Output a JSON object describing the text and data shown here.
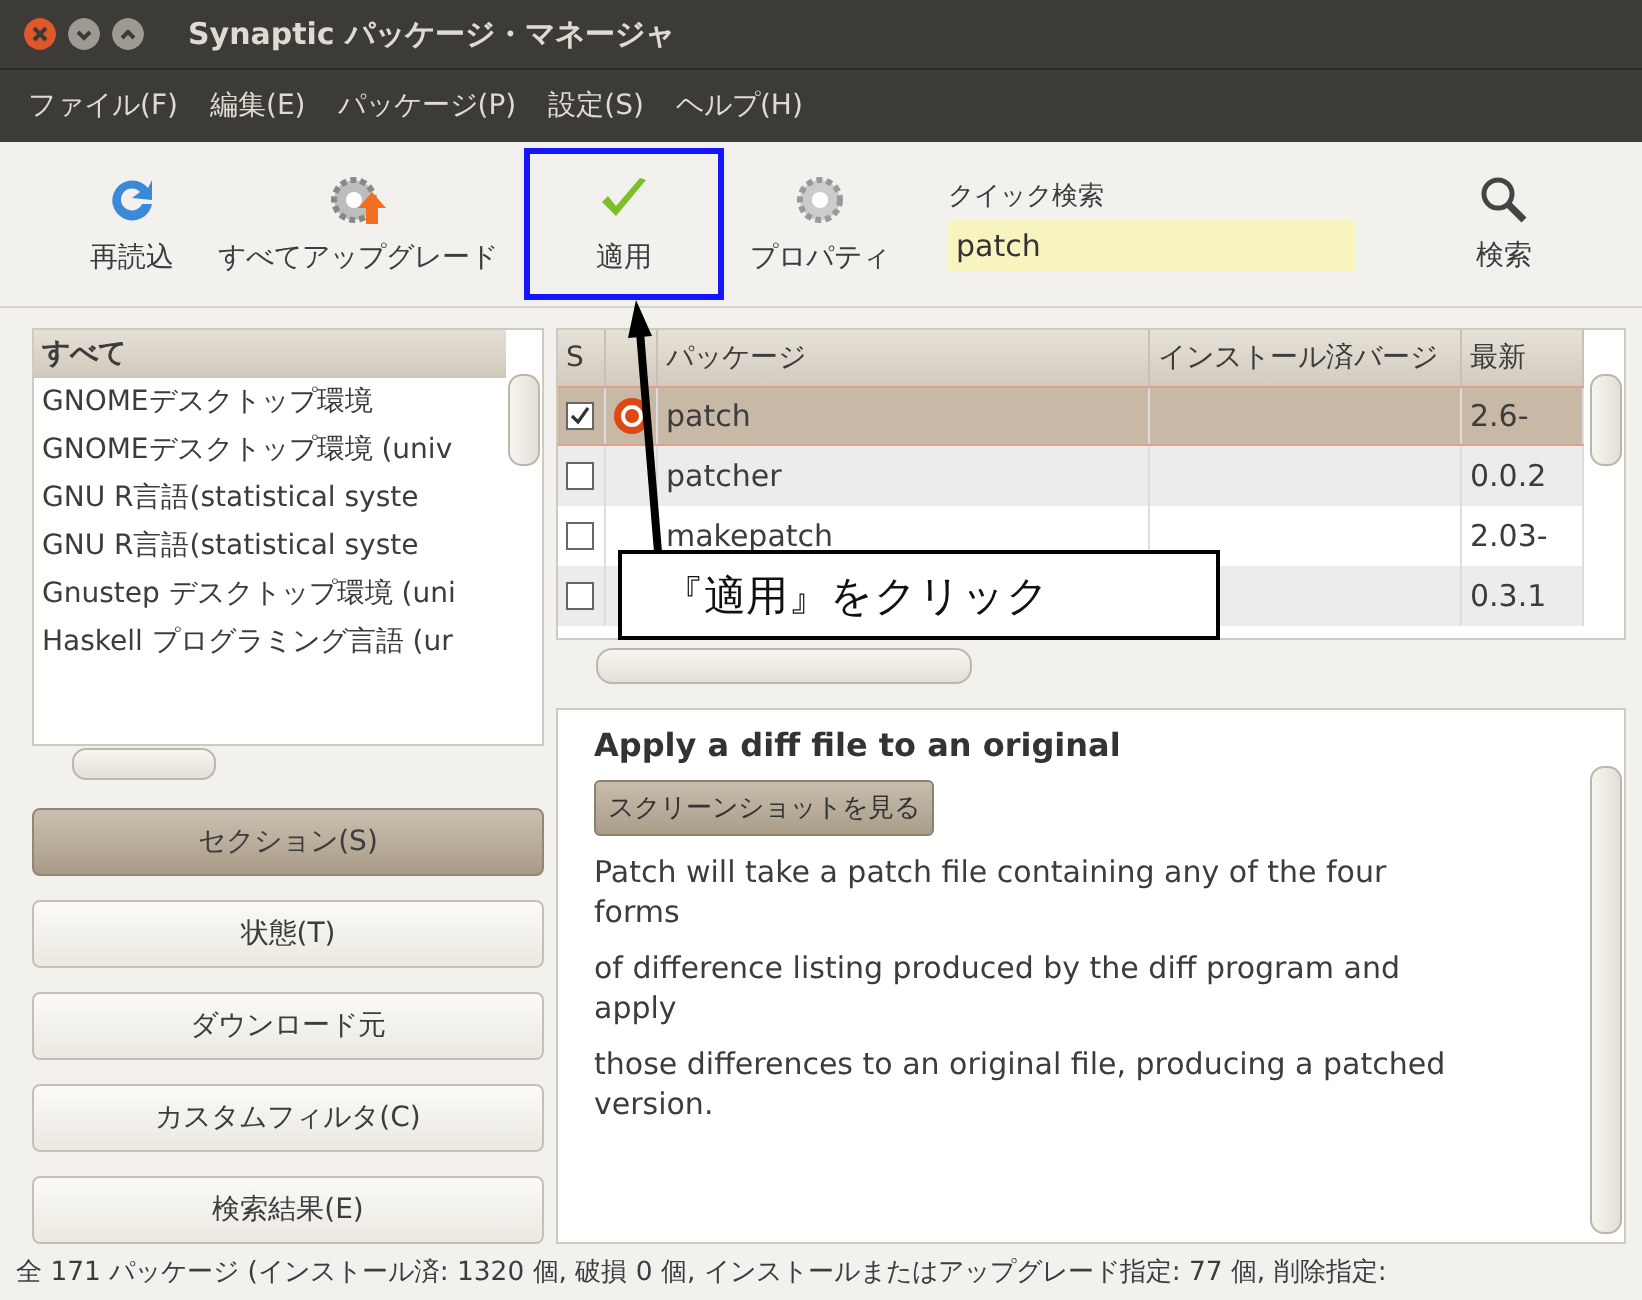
{
  "window": {
    "title": "Synaptic パッケージ・マネージャ"
  },
  "menu": [
    "ファイル(F)",
    "編集(E)",
    "パッケージ(P)",
    "設定(S)",
    "ヘルプ(H)"
  ],
  "toolbar": [
    {
      "label": "再読込",
      "kind": "reload",
      "highlighted": false
    },
    {
      "label": "すべてアップグレード",
      "kind": "upgrade",
      "highlighted": false
    },
    {
      "label": "適用",
      "kind": "apply",
      "highlighted": true
    },
    {
      "label": "プロパティ",
      "kind": "properties",
      "highlighted": false
    }
  ],
  "quick_search": {
    "label": "クイック検索",
    "value": "patch"
  },
  "search_button": {
    "label": "検索"
  },
  "categories": {
    "header": "すべて",
    "items": [
      "GNOMEデスクトップ環境",
      "GNOMEデスクトップ環境 (univ",
      "GNU R言語(statistical syste",
      "GNU R言語(statistical syste",
      "Gnustep デスクトップ環境 (uni",
      "Haskell プログラミング言語 (ur"
    ]
  },
  "filters": [
    {
      "label": "セクション(S)",
      "selected": true
    },
    {
      "label": "状態(T)",
      "selected": false
    },
    {
      "label": "ダウンロード元",
      "selected": false
    },
    {
      "label": "カスタムフィルタ(C)",
      "selected": false
    },
    {
      "label": "検索結果(E)",
      "selected": false
    }
  ],
  "table": {
    "columns": [
      "S",
      "パッケージ",
      "インストール済バージ",
      "最新"
    ],
    "rows": [
      {
        "checked": true,
        "selected": true,
        "supported": true,
        "name": "patch",
        "latest": "2.6-"
      },
      {
        "checked": false,
        "selected": false,
        "supported": false,
        "name": "patcher",
        "latest": "0.0.2"
      },
      {
        "checked": false,
        "selected": false,
        "supported": false,
        "name": "makepatch",
        "latest": "2.03-"
      },
      {
        "checked": false,
        "selected": false,
        "supported": false,
        "latest": "0.3.1"
      }
    ]
  },
  "description": {
    "title": "Apply a diff file to an original",
    "screenshot_button": "スクリーンショットを見る",
    "paragraphs": [
      "Patch will take a patch file containing any of the four forms",
      "of difference listing produced by the diff program and apply",
      "those differences to an original file, producing a patched version."
    ]
  },
  "callout": {
    "text": "『適用』をクリック"
  },
  "status_bar": "全 171 パッケージ (インストール済: 1320 個, 破損 0 個, インストールまたはアップグレード指定: 77 個, 削除指定:"
}
